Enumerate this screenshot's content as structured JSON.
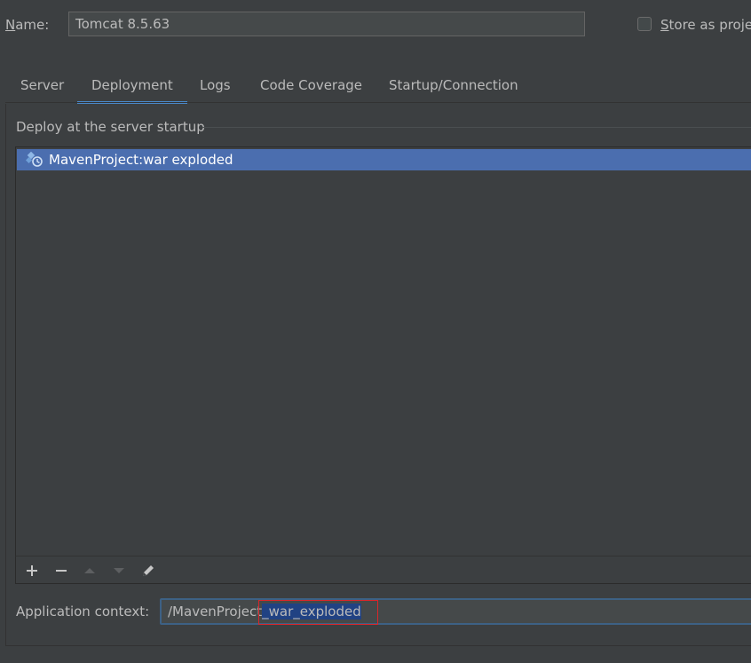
{
  "name_row": {
    "label_first": "N",
    "label_rest": "ame:",
    "value": "Tomcat 8.5.63",
    "store_label_first": "S",
    "store_label_rest": "tore as proje"
  },
  "tabs": [
    {
      "label": "Server"
    },
    {
      "label": "Deployment",
      "active": true
    },
    {
      "label": "Logs"
    },
    {
      "label": "Code Coverage"
    },
    {
      "label": "Startup/Connection"
    }
  ],
  "deploy": {
    "section_title": "Deploy at the server startup",
    "items": [
      {
        "label": "MavenProject:war exploded",
        "icon": "artifact-icon",
        "selected": true
      }
    ],
    "toolbar": {
      "add": "add-icon",
      "remove": "remove-icon",
      "up": "move-up-icon",
      "down": "move-down-icon",
      "edit": "edit-icon"
    }
  },
  "context": {
    "label": "Application context:",
    "value_plain": "/MavenProject",
    "value_selected": "_war_exploded"
  },
  "colors": {
    "background": "#3c3f41",
    "selection": "#4b6eaf",
    "tab_underline": "#4a88c7",
    "text_selection": "#214283",
    "highlight_box": "#d8262b"
  }
}
